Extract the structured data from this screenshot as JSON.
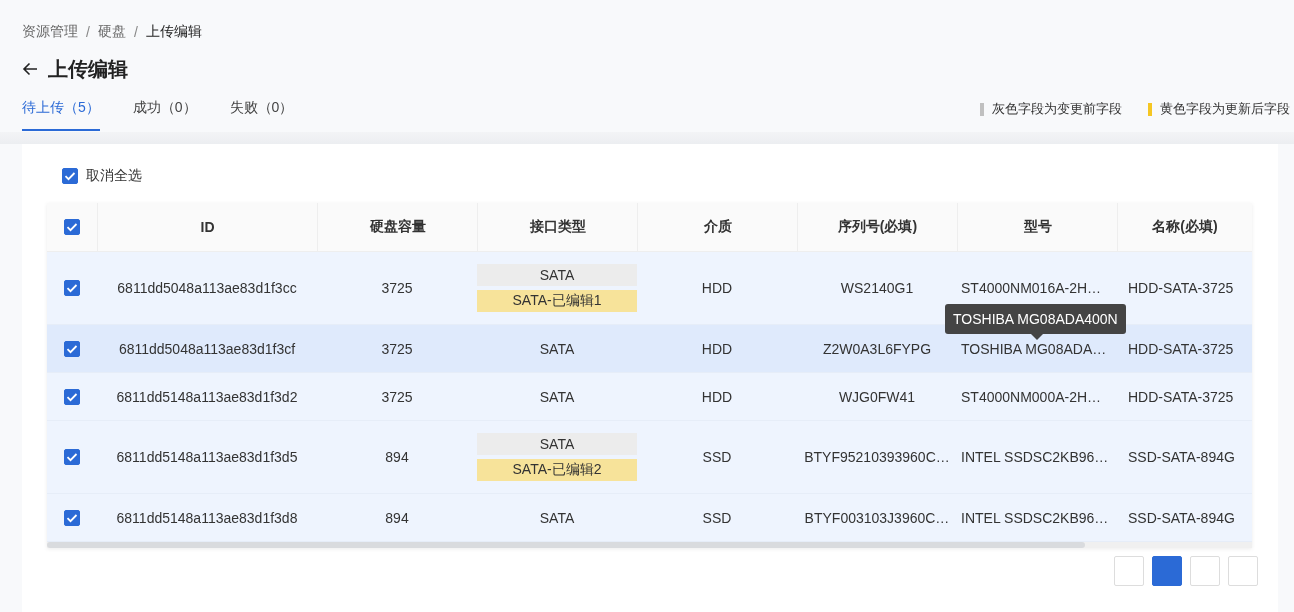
{
  "breadcrumb": [
    "资源管理",
    "/",
    "硬盘",
    "/",
    "上传编辑"
  ],
  "title": "上传编辑",
  "tabs": [
    {
      "label": "待上传（5）",
      "selected": true
    },
    {
      "label": "成功（0）",
      "selected": false
    },
    {
      "label": "失败（0）",
      "selected": false
    }
  ],
  "legend": [
    {
      "label": "灰色字段为变更前字段",
      "color": "#c0c0c0"
    },
    {
      "label": "黄色字段为更新后字段",
      "color": "#f5c623"
    }
  ],
  "select_all": {
    "label": "取消全选",
    "checked": true
  },
  "table": {
    "header_checked": true,
    "columns": [
      "ID",
      "硬盘容量",
      "接口类型",
      "介质",
      "序列号(必填)",
      "型号",
      "名称(必填)"
    ],
    "rows": [
      {
        "checked": true,
        "highlighted": false,
        "id": "6811dd5048a113ae83d1f3cc",
        "capacity": "3725",
        "interface": "SATA",
        "interface_edited": "SATA-已编辑1",
        "medium": "HDD",
        "serial": "WS2140G1",
        "model": "ST4000NM016A-2H…",
        "name": "HDD-SATA-3725"
      },
      {
        "checked": true,
        "highlighted": true,
        "id": "6811dd5048a113ae83d1f3cf",
        "capacity": "3725",
        "interface": "SATA",
        "medium": "HDD",
        "serial": "Z2W0A3L6FYPG",
        "model": "TOSHIBA MG08ADA…",
        "model_tooltip": "TOSHIBA MG08ADA400N",
        "name": "HDD-SATA-3725"
      },
      {
        "checked": true,
        "highlighted": false,
        "id": "6811dd5148a113ae83d1f3d2",
        "capacity": "3725",
        "interface": "SATA",
        "medium": "HDD",
        "serial": "WJG0FW41",
        "model": "ST4000NM000A-2H…",
        "name": "HDD-SATA-3725"
      },
      {
        "checked": true,
        "highlighted": false,
        "id": "6811dd5148a113ae83d1f3d5",
        "capacity": "894",
        "interface": "SATA",
        "interface_edited": "SATA-已编辑2",
        "medium": "SSD",
        "serial": "BTYF95210393960C…",
        "model": "INTEL SSDSC2KB96…",
        "name": "SSD-SATA-894G"
      },
      {
        "checked": true,
        "highlighted": false,
        "id": "6811dd5148a113ae83d1f3d8",
        "capacity": "894",
        "interface": "SATA",
        "medium": "SSD",
        "serial": "BTYF003103J3960C…",
        "model": "INTEL SSDSC2KB96…",
        "name": "SSD-SATA-894G"
      }
    ]
  },
  "pagination": [
    {
      "selected": false
    },
    {
      "selected": true
    },
    {
      "selected": false
    },
    {
      "selected": false
    }
  ]
}
